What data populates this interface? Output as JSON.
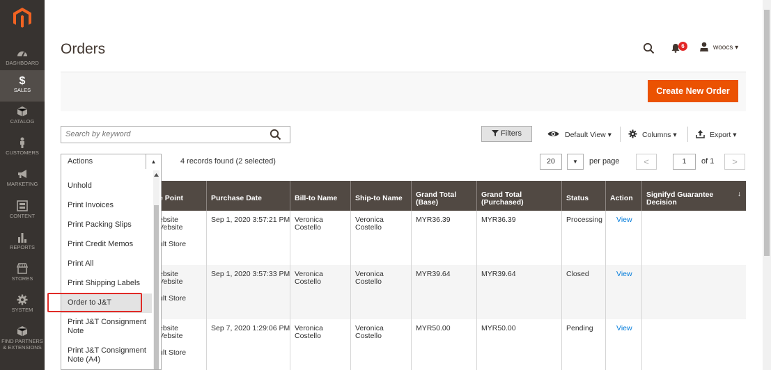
{
  "nav": {
    "items": [
      {
        "label": "DASHBOARD",
        "icon": "dashboard-icon"
      },
      {
        "label": "SALES",
        "icon": "dollar-icon"
      },
      {
        "label": "CATALOG",
        "icon": "box-icon"
      },
      {
        "label": "CUSTOMERS",
        "icon": "person-icon"
      },
      {
        "label": "MARKETING",
        "icon": "megaphone-icon"
      },
      {
        "label": "CONTENT",
        "icon": "content-icon"
      },
      {
        "label": "REPORTS",
        "icon": "bar-chart-icon"
      },
      {
        "label": "STORES",
        "icon": "store-icon"
      },
      {
        "label": "SYSTEM",
        "icon": "gear-icon"
      },
      {
        "label": "FIND PARTNERS",
        "label2": "& EXTENSIONS",
        "icon": "partners-icon"
      }
    ]
  },
  "header": {
    "title": "Orders",
    "notifications": "6",
    "user": "woocs ▾"
  },
  "actions_bar": {
    "create_label": "Create New Order"
  },
  "toolbar": {
    "search_placeholder": "Search by keyword",
    "filters_label": "Filters",
    "view_label": "Default View ▾",
    "columns_label": "Columns ▾",
    "export_label": "Export ▾"
  },
  "massaction": {
    "selected": "Actions",
    "records": "4 records found (2 selected)",
    "options": [
      "Unhold",
      "Print Invoices",
      "Print Packing Slips",
      "Print Credit Memos",
      "Print All",
      "Print Shipping Labels",
      "Order to J&T",
      "Print J&T Consignment",
      "Note",
      "Print J&T Consignment",
      "Note (A4)"
    ]
  },
  "pager": {
    "per_page": "20",
    "per_page_label": "per page",
    "page": "1",
    "of_label": "of 1",
    "prev": "<",
    "next": ">"
  },
  "grid": {
    "columns": [
      "e Point",
      "Purchase Date",
      "Bill-to Name",
      "Ship-to Name",
      "Grand Total (Base)",
      "Grand Total (Purchased)",
      "Status",
      "Action",
      "Signifyd Guarantee Decision"
    ],
    "sort_indicator": "↓",
    "rows": [
      {
        "p1": "ebsite",
        "p2": "Vebsite",
        "p3": "ult Store",
        "date": "Sep 1, 2020 3:57:21 PM",
        "bill1": "Veronica",
        "bill2": "Costello",
        "ship1": "Veronica",
        "ship2": "Costello",
        "base": "MYR36.39",
        "purchased": "MYR36.39",
        "status": "Processing",
        "action": "View"
      },
      {
        "p1": "ebsite",
        "p2": "Vebsite",
        "p3": "ult Store",
        "date": "Sep 1, 2020 3:57:33 PM",
        "bill1": "Veronica",
        "bill2": "Costello",
        "ship1": "Veronica",
        "ship2": "Costello",
        "base": "MYR39.64",
        "purchased": "MYR39.64",
        "status": "Closed",
        "action": "View"
      },
      {
        "p1": "ebsite",
        "p2": "Vebsite",
        "p3": "ult Store",
        "date": "Sep 7, 2020 1:29:06 PM",
        "bill1": "Veronica",
        "bill2": "Costello",
        "ship1": "Veronica",
        "ship2": "Costello",
        "base": "MYR50.00",
        "purchased": "MYR50.00",
        "status": "Pending",
        "action": "View"
      }
    ]
  },
  "colors": {
    "sidebar": "#373330",
    "accent": "#eb5202",
    "grid_header": "#514943",
    "link": "#007bdb",
    "highlight": "#e02b27"
  }
}
